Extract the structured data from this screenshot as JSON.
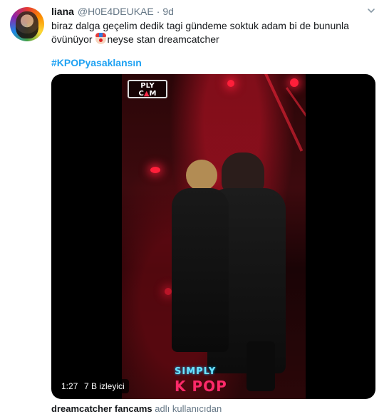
{
  "tweet": {
    "display_name": "liana",
    "handle": "@H0E4DEUKAE",
    "separator": "·",
    "time": "9d",
    "text_part1": "biraz dalga geçelim dedik tagi gündeme soktuk adam bi de bununla övünüyor ",
    "emoji": "clown-face-emoji",
    "text_part2": "neyse stan dreamcatcher",
    "hashtag": "#KPOPyasaklansın"
  },
  "video": {
    "duration": "1:27",
    "views": "7 B izleyici",
    "overlay_logo_top": "PLY",
    "overlay_logo_bottom_a": "C",
    "overlay_logo_bottom_b": "▲",
    "overlay_logo_bottom_c": "M",
    "overlay_simply": "SIMPLY",
    "overlay_kpop": "K POP"
  },
  "source": {
    "account": "dreamcatcher fancams",
    "suffix": "adlı kullanıcıdan"
  },
  "icons": {
    "menu": "chevron-down-icon",
    "avatar": "profile-avatar"
  },
  "colors": {
    "link": "#1da1f2",
    "muted": "#657786",
    "text": "#14171a"
  }
}
